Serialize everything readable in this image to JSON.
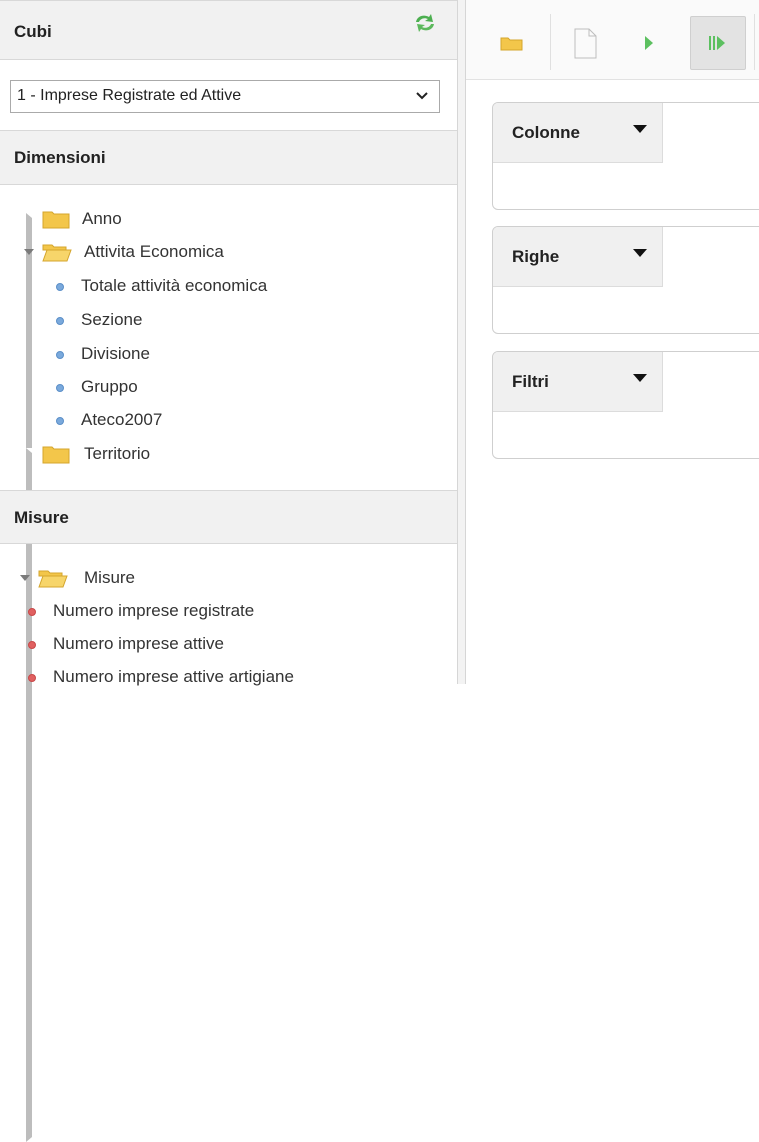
{
  "cubi": {
    "title": "Cubi",
    "selected": "1 - Imprese Registrate ed Attive"
  },
  "dimensioni": {
    "title": "Dimensioni",
    "items": [
      {
        "label": "Anno"
      },
      {
        "label": "Attivita Economica"
      },
      {
        "label": "Totale attività economica"
      },
      {
        "label": "Sezione"
      },
      {
        "label": "Divisione"
      },
      {
        "label": "Gruppo"
      },
      {
        "label": "Ateco2007"
      },
      {
        "label": "Territorio"
      }
    ]
  },
  "misure": {
    "title": "Misure",
    "items": [
      {
        "label": "Misure"
      },
      {
        "label": "Numero imprese registrate"
      },
      {
        "label": "Numero imprese attive"
      },
      {
        "label": "Numero imprese attive artigiane"
      }
    ]
  },
  "panels": {
    "colonne": "Colonne",
    "righe": "Righe",
    "filtri": "Filtri"
  },
  "colors": {
    "refresh_icon": "#4caf50",
    "folder": "#f0c040",
    "dim_dot": "#7aa9dc",
    "measure_dot": "#e06060"
  }
}
